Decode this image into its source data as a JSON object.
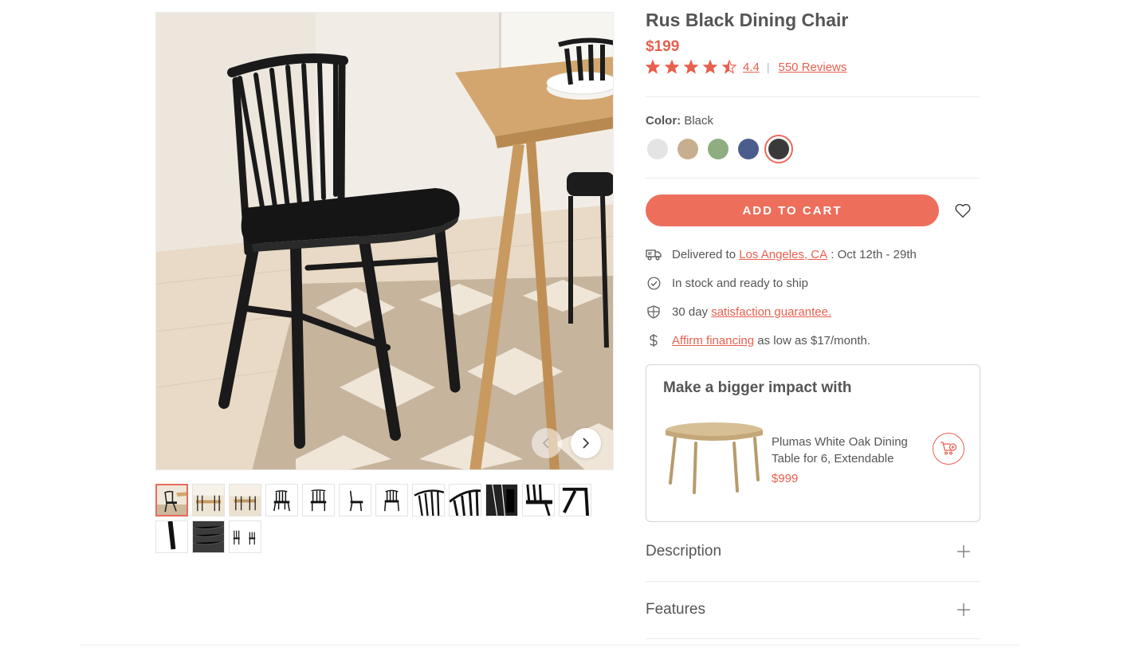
{
  "product": {
    "title": "Rus Black Dining Chair",
    "price": "$199",
    "rating": 4.4,
    "rating_text": "4.4",
    "reviews_text": "550 Reviews",
    "rating_separator": "|"
  },
  "color": {
    "label": "Color:",
    "selected": "Black",
    "swatches": [
      {
        "name": "white-swatch",
        "color": "#e4e4e4"
      },
      {
        "name": "natural-oak-swatch",
        "color": "#c7ae8e"
      },
      {
        "name": "sage-green-swatch",
        "color": "#8fae80"
      },
      {
        "name": "navy-blue-swatch",
        "color": "#4b5d8c"
      },
      {
        "name": "black-swatch",
        "color": "#3a3a3a",
        "selected": true
      }
    ]
  },
  "cart": {
    "add_to_cart_label": "ADD TO CART",
    "accent_color": "#ee6e5c"
  },
  "features": {
    "delivery_prefix": "Delivered to",
    "delivery_location": "Los Angeles, CA",
    "delivery_dates": ": Oct 12th - 29th",
    "stock": "In stock and ready to ship",
    "guarantee_prefix": "30 day",
    "guarantee_link": "satisfaction guarantee.",
    "financing_link": "Affirm financing",
    "financing_suffix": "as low as $17/month."
  },
  "upsell": {
    "heading": "Make a bigger impact with",
    "product_name": "Plumas White Oak Dining Table for 6, Extendable",
    "product_price": "$999"
  },
  "accordions": {
    "description": "Description",
    "features": "Features"
  },
  "gallery": {
    "thumbnail_count": 15,
    "active_thumbnail": 1
  }
}
